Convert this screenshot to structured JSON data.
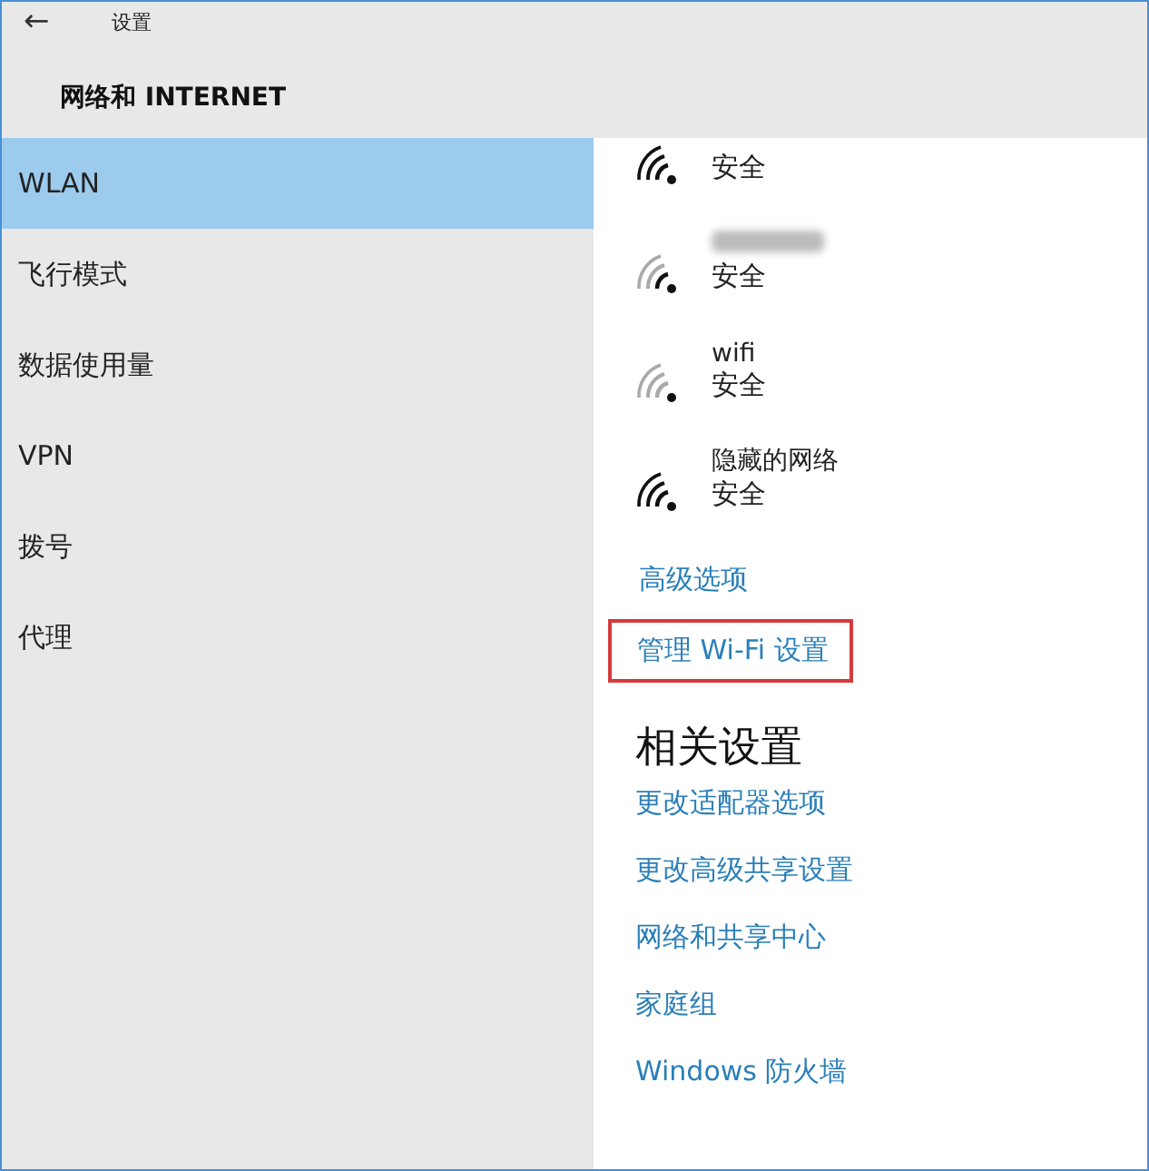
{
  "header": {
    "back": "←",
    "app_title": "设置",
    "section_title": "网络和 INTERNET"
  },
  "sidebar": {
    "items": [
      {
        "label": "WLAN",
        "selected": true
      },
      {
        "label": "飞行模式",
        "selected": false
      },
      {
        "label": "数据使用量",
        "selected": false
      },
      {
        "label": "VPN",
        "selected": false
      },
      {
        "label": "拨号",
        "selected": false
      },
      {
        "label": "代理",
        "selected": false
      }
    ]
  },
  "networks": [
    {
      "kind": "strong",
      "status": "安全"
    },
    {
      "kind": "medium",
      "name_blurred": true,
      "status": "安全"
    },
    {
      "kind": "weak",
      "name": "wifi",
      "status": "安全"
    },
    {
      "kind": "strong",
      "name": "隐藏的网络",
      "status": "安全"
    }
  ],
  "links": [
    {
      "label": "高级选项",
      "highlighted": false
    },
    {
      "label": "管理 Wi-Fi 设置",
      "highlighted": true
    }
  ],
  "related": {
    "heading": "相关设置",
    "links": [
      "更改适配器选项",
      "更改高级共享设置",
      "网络和共享中心",
      "家庭组",
      "Windows 防火墙"
    ]
  }
}
